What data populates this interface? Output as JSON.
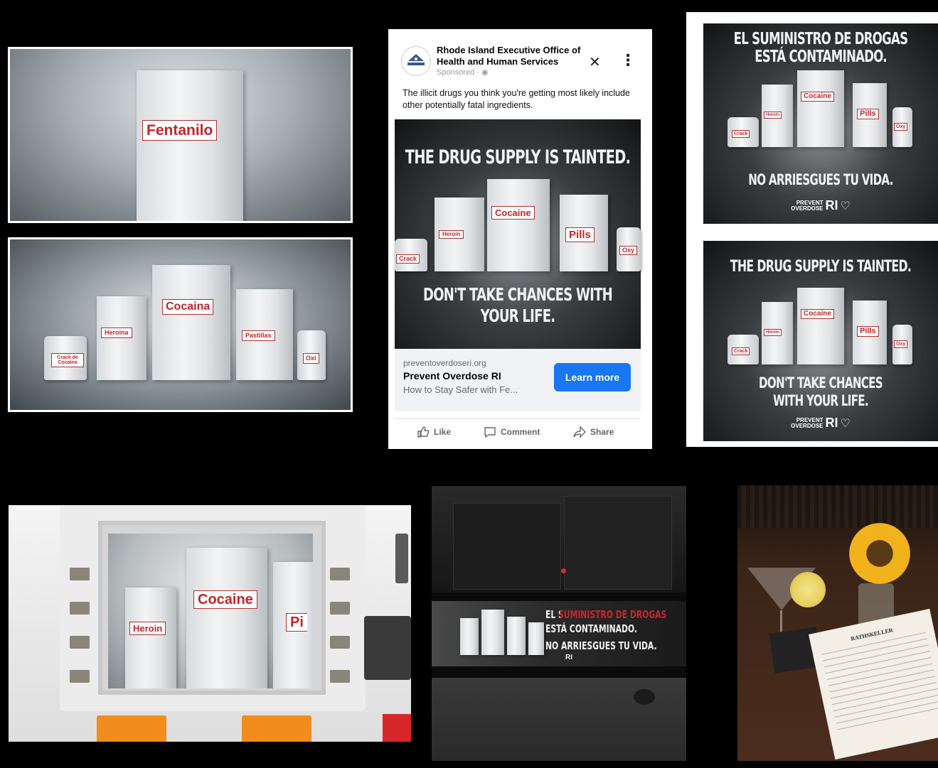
{
  "top_left_top": {
    "label": "Fentanilo"
  },
  "top_left_bottom": {
    "labels": {
      "cocaina": "Cocaina",
      "heroina": "Heroina",
      "pastillas": "Pastillas",
      "crack": "Crack de Cocaína",
      "oxi": "Oxi"
    }
  },
  "facebook_ad": {
    "advertiser": "Rhode Island Executive Office of Health and Human Services",
    "sponsored": "Sponsored · ",
    "caption": "The illicit drugs you think you're getting most likely include other potentially fatal ingredients.",
    "headline": "THE DRUG SUPPLY IS TAINTED.",
    "tagline": "DON'T TAKE CHANCES WITH YOUR LIFE.",
    "labels": {
      "cocaine": "Cocaine",
      "heroin": "Heroin",
      "pills": "Pills",
      "crack": "Crack",
      "oxy": "Oxy"
    },
    "link_domain": "preventoverdoseri.org",
    "link_title": "Prevent Overdose RI",
    "link_description": "How to Stay Safer with Fe...",
    "cta": "Learn more",
    "actions": {
      "like": "Like",
      "comment": "Comment",
      "share": "Share"
    },
    "close_symbol": "✕",
    "menu_symbol": "⋮"
  },
  "spanish_ad": {
    "headline": "EL SUMINISTRO DE DROGAS ESTÁ CONTAMINADO.",
    "tagline": "NO ARRIESGUES TU VIDA.",
    "labels": {
      "cocaine": "Cocaine",
      "heroin": "Heroin",
      "pills": "Pills",
      "crack": "Crack",
      "oxy": "Oxy"
    },
    "logo": {
      "prevent": "PREVENT",
      "overdose": "OVERDOSE",
      "ri": "RI"
    }
  },
  "english_ad": {
    "headline": "THE DRUG SUPPLY IS TAINTED.",
    "tagline": "DON'T TAKE CHANCES WITH YOUR LIFE.",
    "labels": {
      "cocaine": "Cocaine",
      "heroin": "Heroin",
      "pills": "Pills",
      "crack": "Crack",
      "oxy": "Oxy"
    },
    "logo": {
      "prevent": "PREVENT",
      "overdose": "OVERDOSE",
      "ri": "RI"
    }
  },
  "gas_pump": {
    "labels": {
      "cocaine": "Cocaine",
      "heroin": "Heroin",
      "pills": "Pi"
    }
  },
  "bus_ad": {
    "line1": "EL SUMINISTRO DE DROGAS",
    "line2": "ESTÁ CONTAMINADO.",
    "line3": "NO ARRIESGUES TU VIDA.",
    "logo": "RI"
  },
  "restaurant": {
    "menu_title": "RATHSKELLER"
  }
}
